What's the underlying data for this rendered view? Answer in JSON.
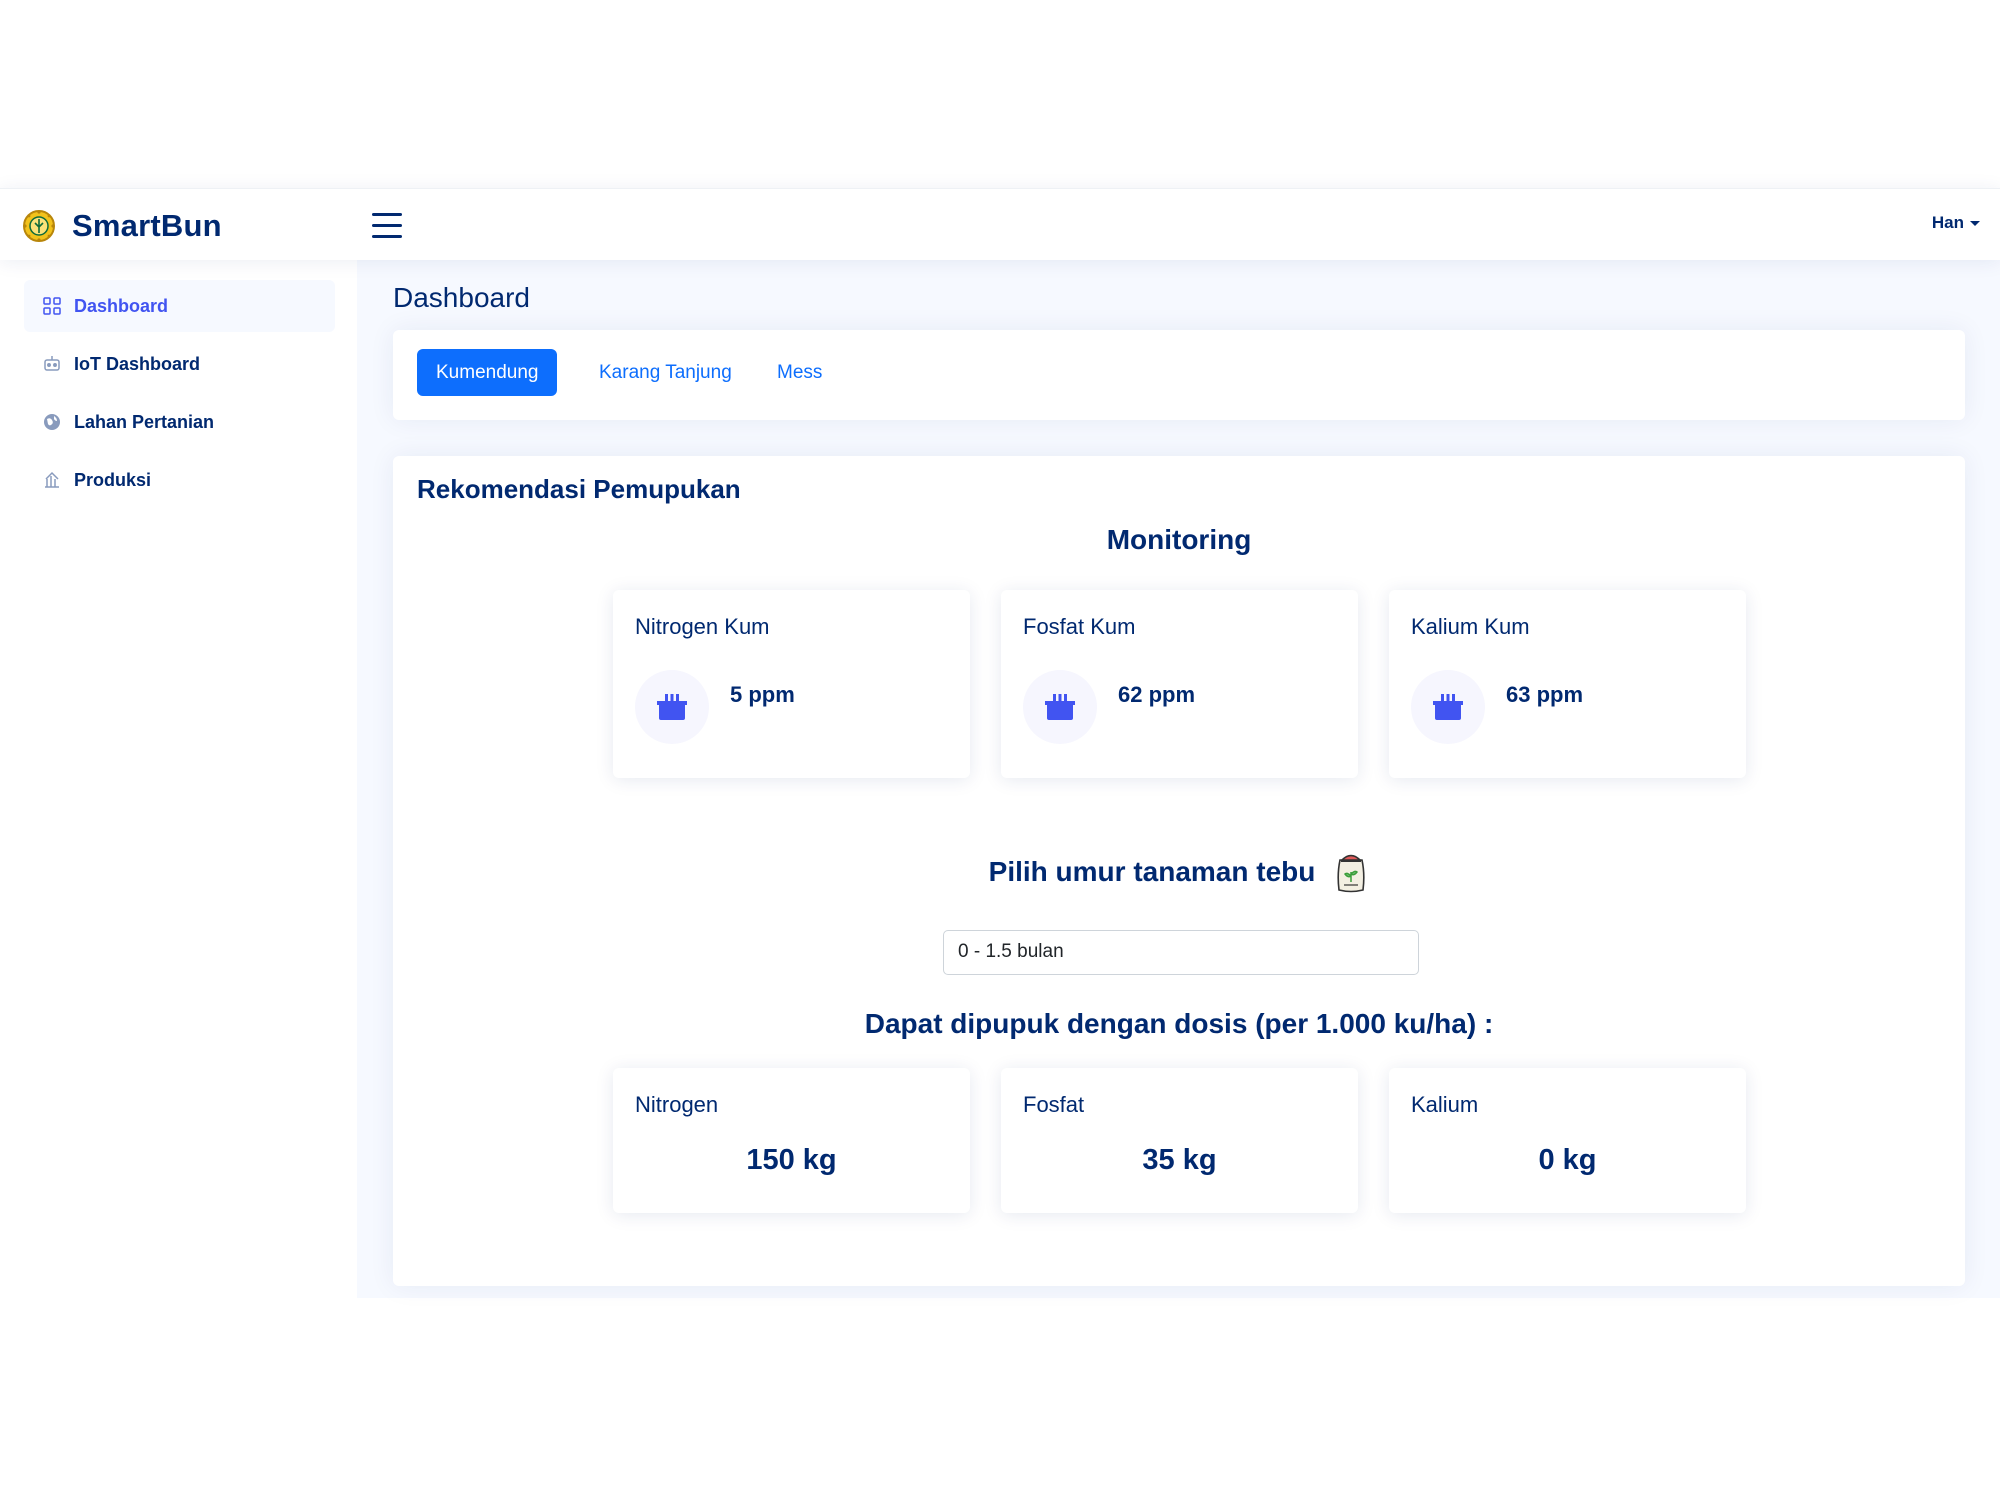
{
  "header": {
    "app_name": "SmartBun",
    "user_name": "Han"
  },
  "sidebar": {
    "items": [
      {
        "label": "Dashboard",
        "icon": "grid-icon",
        "active": true
      },
      {
        "label": "IoT Dashboard",
        "icon": "robot-icon",
        "active": false
      },
      {
        "label": "Lahan Pertanian",
        "icon": "globe-icon",
        "active": false
      },
      {
        "label": "Produksi",
        "icon": "bank-icon",
        "active": false
      }
    ]
  },
  "main": {
    "page_title": "Dashboard",
    "tabs": [
      {
        "label": "Kumendung",
        "active": true
      },
      {
        "label": "Karang Tanjung",
        "active": false
      },
      {
        "label": "Mess",
        "active": false
      }
    ],
    "card_title": "Rekomendasi Pemupukan",
    "monitoring_title": "Monitoring",
    "metrics": [
      {
        "name": "Nitrogen Kum",
        "value": "5 ppm",
        "icon": "box-icon"
      },
      {
        "name": "Fosfat Kum",
        "value": "62 ppm",
        "icon": "box-icon"
      },
      {
        "name": "Kalium Kum",
        "value": "63 ppm",
        "icon": "box-icon"
      }
    ],
    "age_prompt": "Pilih umur tanaman tebu",
    "age_select_value": "0 - 1.5 bulan",
    "dose_title": "Dapat dipupuk dengan dosis (per 1.000 ku/ha) :",
    "doses": [
      {
        "name": "Nitrogen",
        "value": "150 kg"
      },
      {
        "name": "Fosfat",
        "value": "35 kg"
      },
      {
        "name": "Kalium",
        "value": "0 kg"
      }
    ]
  },
  "colors": {
    "brand_navy": "#012970",
    "accent_blue": "#0d6efd",
    "icon_indigo": "#4154f1",
    "page_background": "#f6f9ff"
  }
}
